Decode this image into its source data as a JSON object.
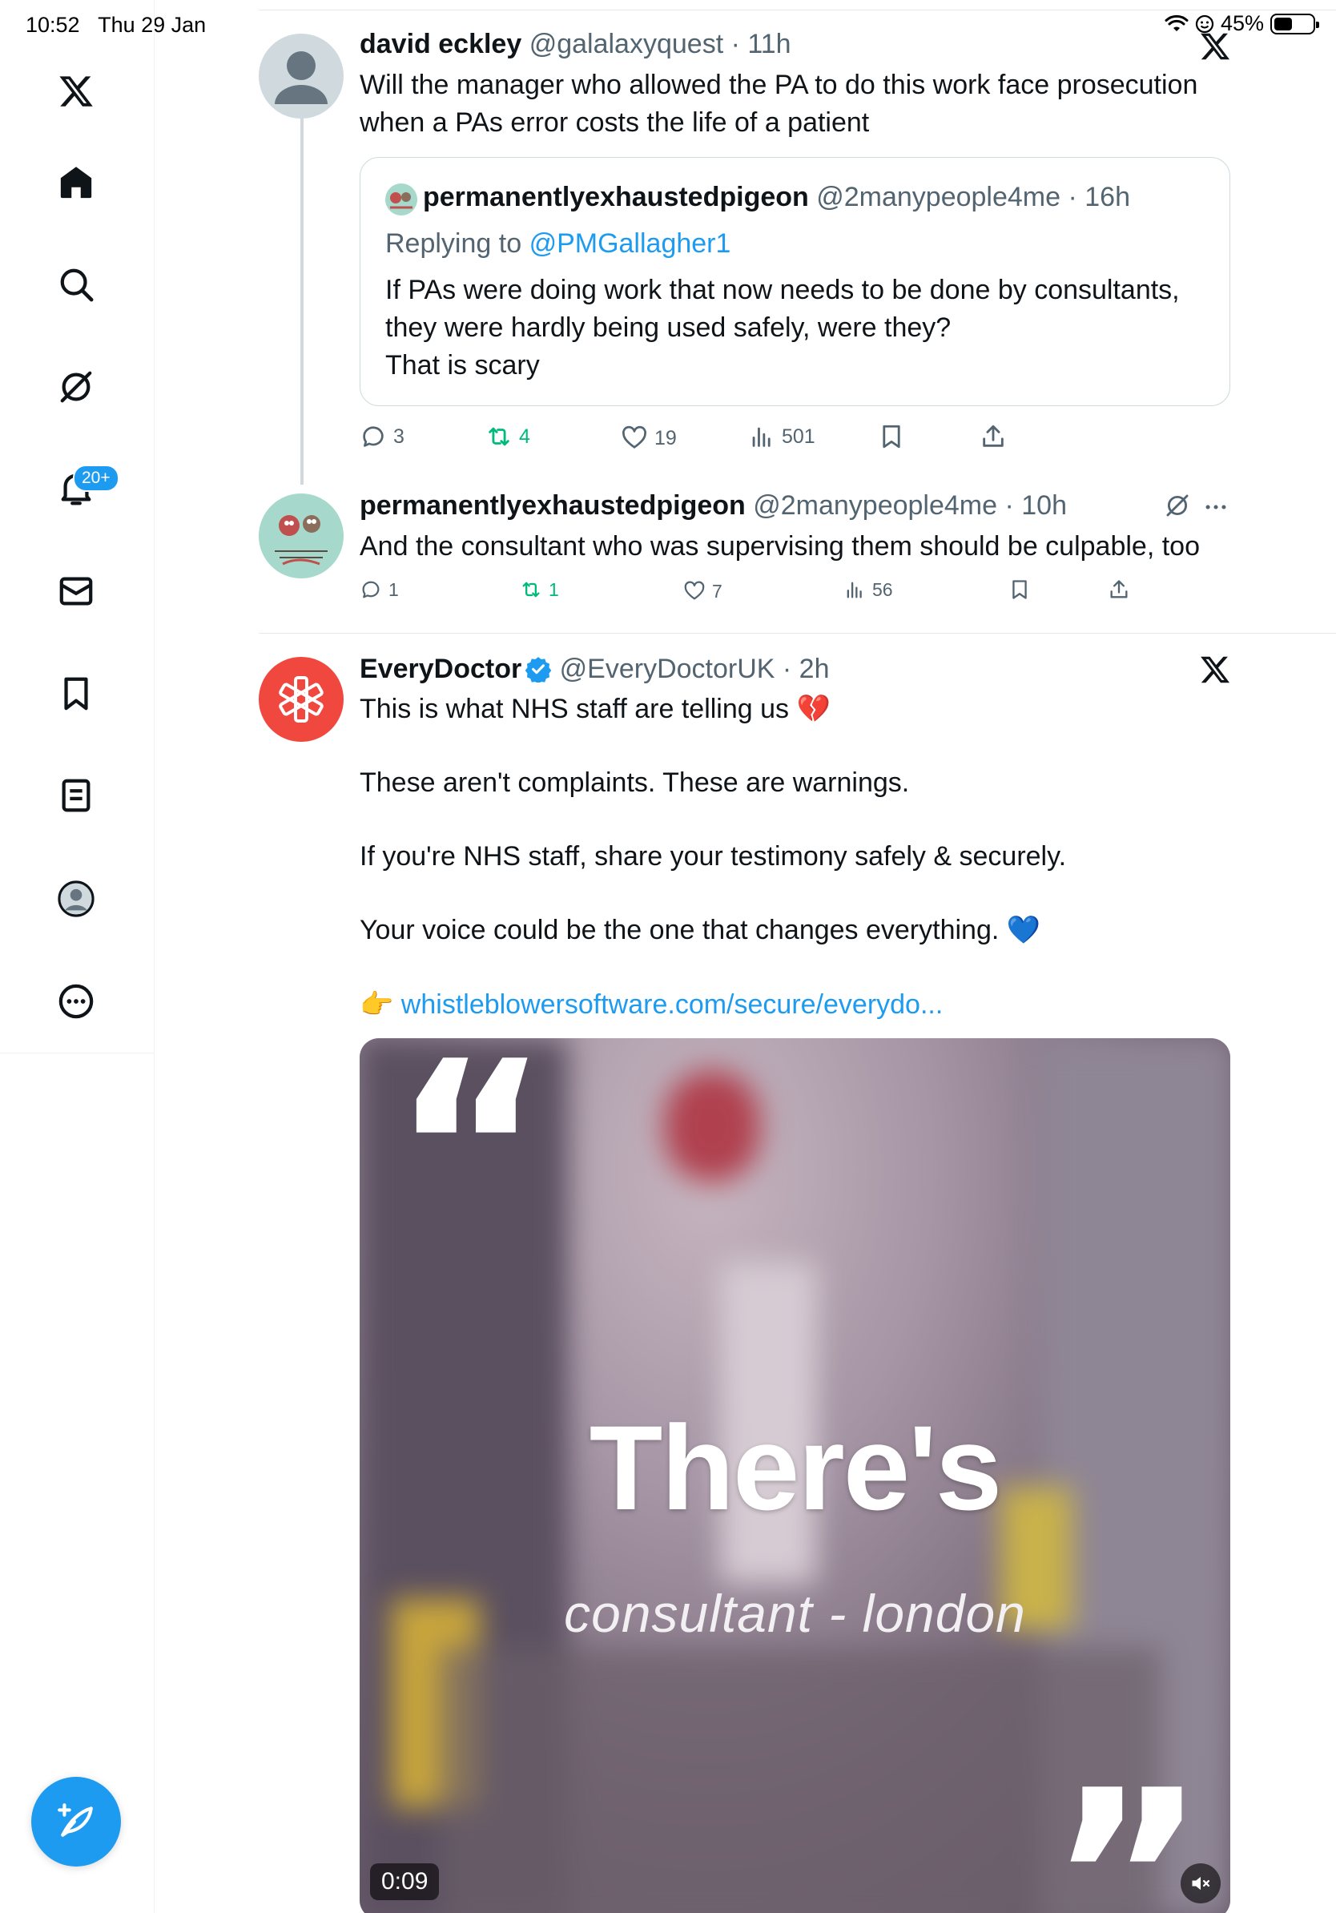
{
  "status_bar": {
    "time": "10:52",
    "date": "Thu 29 Jan",
    "battery": "45%"
  },
  "sidebar": {
    "items": [
      {
        "icon": "x-logo-icon"
      },
      {
        "icon": "home-icon"
      },
      {
        "icon": "search-icon"
      },
      {
        "icon": "grok-icon"
      },
      {
        "icon": "notifications-icon",
        "badge": "20+"
      },
      {
        "icon": "messages-icon"
      },
      {
        "icon": "bookmarks-icon"
      },
      {
        "icon": "lists-icon"
      },
      {
        "icon": "profile-icon"
      },
      {
        "icon": "more-icon"
      }
    ],
    "compose_icon": "compose-icon"
  },
  "tweet1": {
    "name": "david eckley",
    "handle": "@galalaxyquest",
    "time": "11h",
    "text_lines": [
      "Will the manager who allowed the PA to do this work face prosecution",
      "when a PAs error  costs the  life of a patient"
    ],
    "quote": {
      "name": "permanentlyexhaustedpigeon",
      "handle": "@2manypeople4me",
      "time": "16h",
      "replying_prefix": "Replying to",
      "replying_to": "@PMGallagher1",
      "text_lines": [
        "If PAs were doing work that now needs to be done by consultants,",
        "they were hardly being used safely, were they?",
        "That is scary"
      ]
    },
    "replies": "3",
    "reposts": "4",
    "likes": "19",
    "views": "501"
  },
  "tweet2": {
    "name": "permanentlyexhaustedpigeon",
    "handle": "@2manypeople4me",
    "time": "10h",
    "text": "And the consultant who was supervising them should be culpable, too",
    "replies": "1",
    "reposts": "1",
    "likes": "7",
    "views": "56"
  },
  "tweet3": {
    "name": "EveryDoctor",
    "handle": "@EveryDoctorUK",
    "time": "2h",
    "line1": "This is what NHS staff are telling us 💔",
    "line2": "These aren't complaints. These are warnings.",
    "line3": "If you're NHS staff, share your testimony safely & securely.",
    "line4": "Your voice could be the one that changes everything. 💙",
    "link_emoji": "👉",
    "link": "whistleblowersoftware.com/secure/everydo...",
    "video": {
      "headline": "There's",
      "caption": "consultant - london",
      "open_quote": "“",
      "close_quote": "”",
      "duration": "0:09"
    }
  },
  "colors": {
    "accent": "#1d9bf0",
    "repost_green": "#00ba7c",
    "secondary_text": "#536471",
    "everydoctor_red": "#f0483e"
  }
}
